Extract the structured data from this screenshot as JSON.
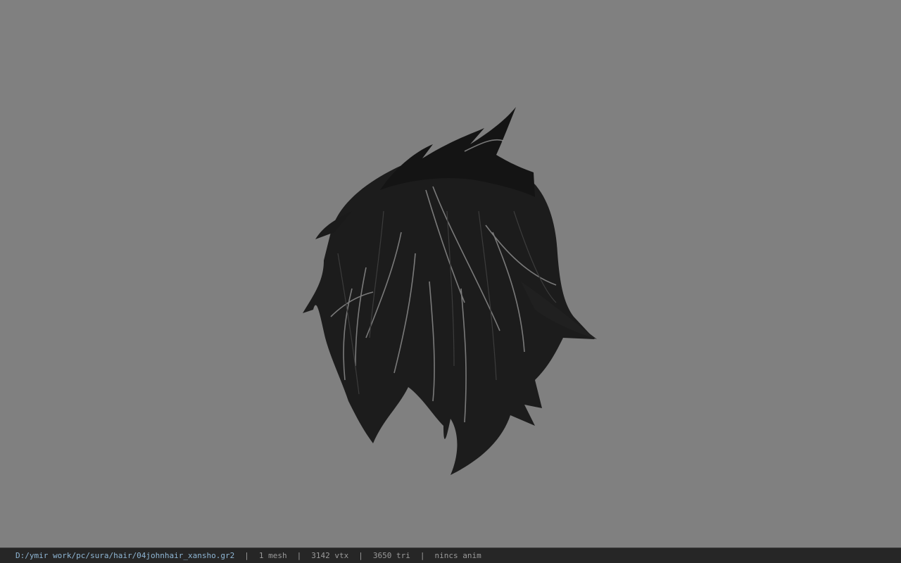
{
  "viewport": {
    "background_color": "#808080",
    "model_label": "hair mesh"
  },
  "status_bar": {
    "file_path": "D:/ymir work/pc/sura/hair/04johnhair_xansho.gr2",
    "mesh_count": "1 mesh",
    "vertex_count": "3142 vtx",
    "triangle_count": "3650 tri",
    "animation": "nincs anim",
    "separator": "|",
    "path_color": "#8fb6d4",
    "text_color": "#9a9a9a"
  }
}
